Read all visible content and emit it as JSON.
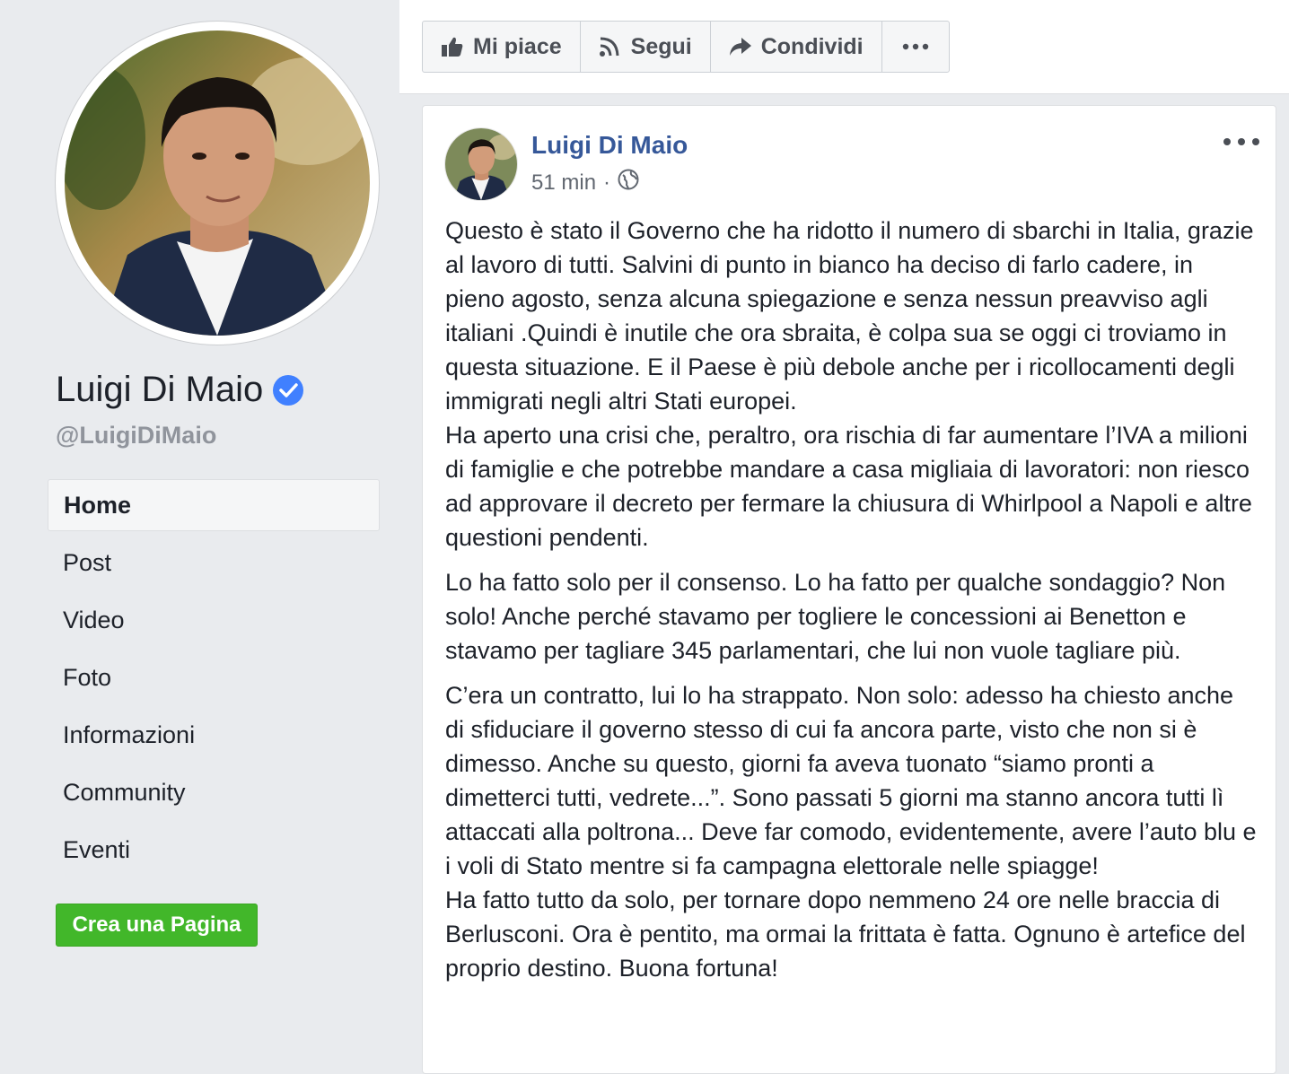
{
  "sidebar": {
    "page_name": "Luigi Di Maio",
    "handle": "@LuigiDiMaio",
    "verified_icon": "verified-badge-icon",
    "nav": [
      {
        "label": "Home",
        "active": true
      },
      {
        "label": "Post"
      },
      {
        "label": "Video"
      },
      {
        "label": "Foto"
      },
      {
        "label": "Informazioni"
      },
      {
        "label": "Community"
      },
      {
        "label": "Eventi"
      }
    ],
    "create_page_label": "Crea una Pagina"
  },
  "actions": {
    "like_label": "Mi piace",
    "follow_label": "Segui",
    "share_label": "Condividi",
    "more_icon": "more-horizontal-icon"
  },
  "post": {
    "author": "Luigi Di Maio",
    "time": "51 min",
    "separator": "·",
    "privacy_icon": "globe-icon",
    "paragraphs": [
      "Questo è stato il Governo che ha ridotto il numero di sbarchi in Italia, grazie al lavoro di tutti. Salvini di punto in bianco ha deciso di farlo cadere, in pieno agosto, senza alcuna spiegazione e senza nessun preavviso agli italiani .Quindi è inutile che ora sbraita, è colpa sua se oggi ci troviamo in questa situazione. E il Paese è più debole anche per i ricollocamenti degli immigrati negli altri Stati europei.",
      "Ha aperto una crisi che, peraltro, ora rischia di far aumentare l’IVA a milioni di famiglie e che potrebbe mandare a casa migliaia di lavoratori: non riesco ad approvare il decreto per fermare la chiusura di Whirlpool a Napoli e altre questioni pendenti.",
      "Lo ha fatto solo per il consenso. Lo ha fatto per qualche sondaggio? Non solo! Anche perché stavamo per togliere le concessioni ai Benetton e stavamo per tagliare 345 parlamentari, che lui non vuole tagliare più.",
      "C’era un contratto, lui lo ha strappato. Non solo: adesso ha chiesto anche di sfiduciare il governo stesso di cui fa ancora parte, visto che non si è dimesso. Anche su questo, giorni fa aveva tuonato “siamo pronti a dimetterci tutti, vedrete...”. Sono passati 5 giorni ma stanno ancora tutti lì attaccati alla poltrona... Deve far comodo, evidentemente, avere l’auto blu e i voli di Stato mentre si fa campagna elettorale nelle spiagge!",
      "Ha fatto tutto da solo, per tornare dopo nemmeno 24 ore nelle braccia di Berlusconi. Ora è pentito, ma ormai la frittata è fatta. Ognuno è artefice del proprio destino. Buona fortuna!"
    ]
  }
}
